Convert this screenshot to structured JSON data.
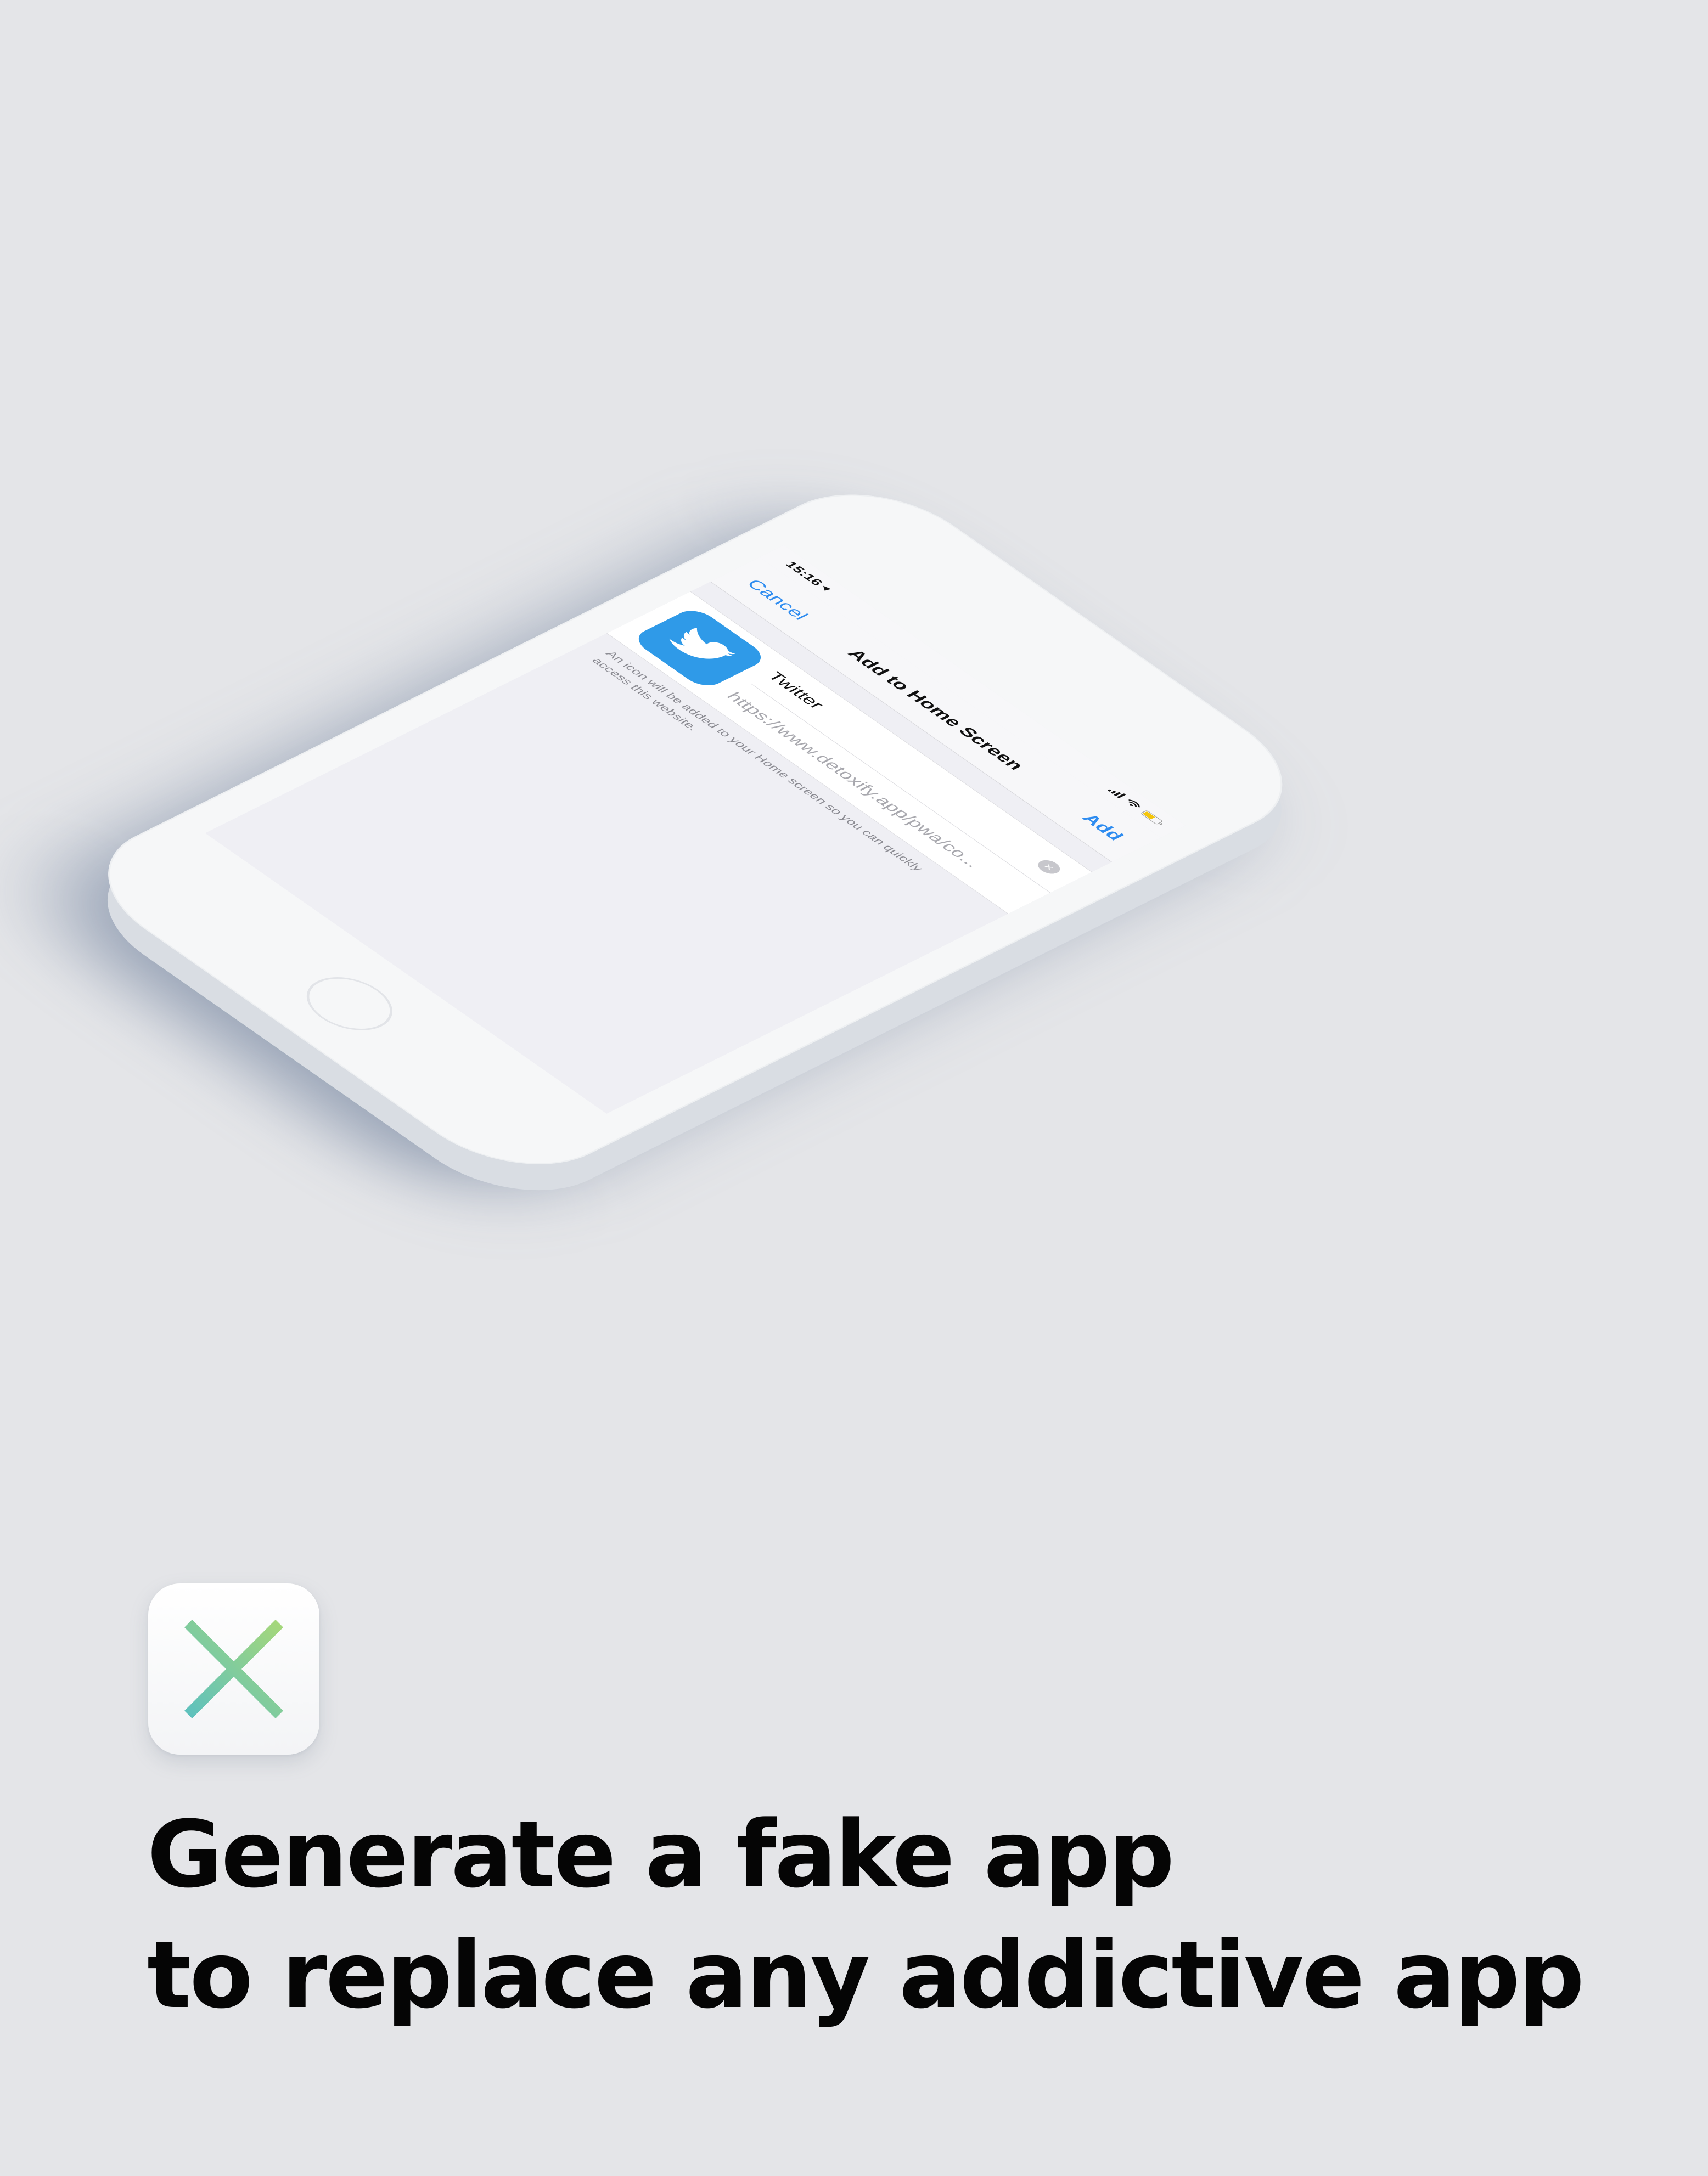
{
  "status_bar": {
    "time": "15:16"
  },
  "sheet": {
    "cancel_label": "Cancel",
    "title": "Add to Home Screen",
    "add_label": "Add",
    "app_name": "Twitter",
    "url": "https://www.detoxify.app/pwa/co...",
    "note": "An icon will be added to your Home screen so you can quickly access this website.",
    "app_icon": "twitter-bird-icon",
    "accent_color": "#2e8cf0",
    "icon_color": "#2f9ae8"
  },
  "brand": {
    "logo_icon": "cross-x-icon",
    "logo_gradient": [
      "#5bc0c0",
      "#a8d878"
    ]
  },
  "headline": {
    "line1": "Generate a fake app",
    "line2": "to replace any addictive app"
  },
  "colors": {
    "background": "#e4e5e8",
    "text": "#050505"
  }
}
